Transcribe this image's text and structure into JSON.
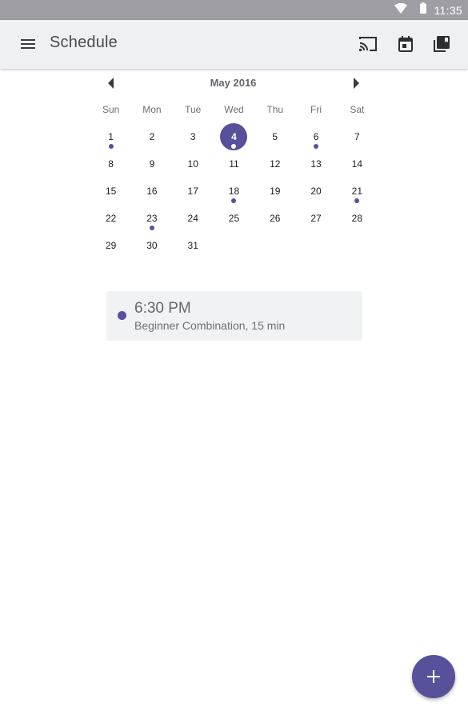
{
  "status_bar": {
    "time": "11:35",
    "icons": [
      "wifi-icon",
      "battery-icon"
    ]
  },
  "toolbar": {
    "title": "Schedule",
    "icons": [
      "menu-icon",
      "cast-icon",
      "calendar-icon",
      "library-icon"
    ]
  },
  "calendar": {
    "month_label": "May 2016",
    "weekdays": [
      "Sun",
      "Mon",
      "Tue",
      "Wed",
      "Thu",
      "Fri",
      "Sat"
    ],
    "weeks": [
      [
        {
          "d": "1",
          "dot": true
        },
        {
          "d": "2"
        },
        {
          "d": "3"
        },
        {
          "d": "4",
          "dot": true,
          "selected": true
        },
        {
          "d": "5"
        },
        {
          "d": "6",
          "dot": true
        },
        {
          "d": "7"
        }
      ],
      [
        {
          "d": "8"
        },
        {
          "d": "9"
        },
        {
          "d": "10"
        },
        {
          "d": "11"
        },
        {
          "d": "12"
        },
        {
          "d": "13"
        },
        {
          "d": "14"
        }
      ],
      [
        {
          "d": "15"
        },
        {
          "d": "16"
        },
        {
          "d": "17"
        },
        {
          "d": "18",
          "dot": true
        },
        {
          "d": "19"
        },
        {
          "d": "20"
        },
        {
          "d": "21",
          "dot": true
        }
      ],
      [
        {
          "d": "22"
        },
        {
          "d": "23",
          "dot": true
        },
        {
          "d": "24"
        },
        {
          "d": "25"
        },
        {
          "d": "26"
        },
        {
          "d": "27"
        },
        {
          "d": "28"
        }
      ],
      [
        {
          "d": "29"
        },
        {
          "d": "30"
        },
        {
          "d": "31"
        }
      ]
    ]
  },
  "event": {
    "time": "6:30 PM",
    "description": "Beginner Combination, 15 min"
  },
  "fab": {
    "icon": "plus-icon"
  },
  "colors": {
    "accent": "#57509a",
    "toolbar_bg": "#eef0f3",
    "status_bar_bg": "#9e9ea4",
    "card_bg": "#f1f2f4"
  }
}
